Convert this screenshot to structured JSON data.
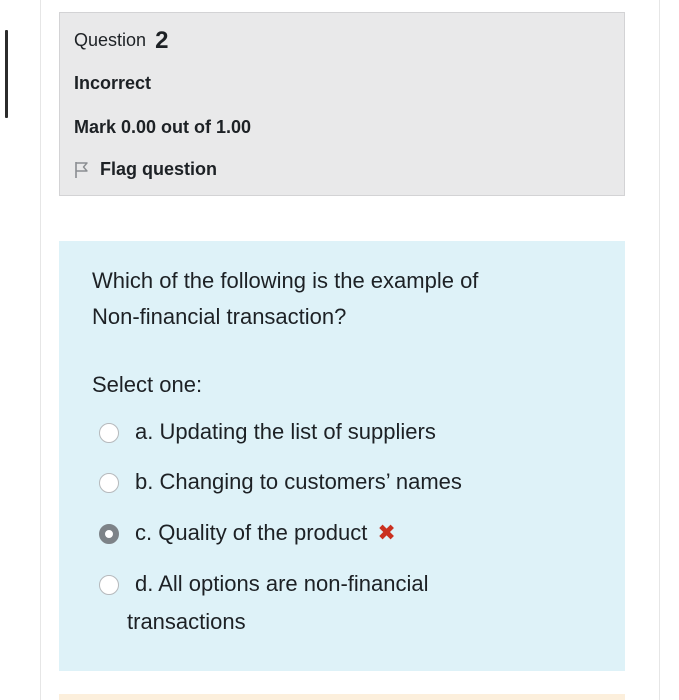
{
  "question_info": {
    "label": "Question",
    "number": "2",
    "state": "Incorrect",
    "grade": "Mark 0.00 out of 1.00",
    "flag_label": "Flag question"
  },
  "question": {
    "text_line1": "Which of the following is the example of",
    "text_line2": "Non-financial transaction?",
    "prompt": "Select one:",
    "answers": [
      {
        "label": "a. Updating the list of suppliers",
        "selected": false
      },
      {
        "label": "b. Changing to customers’ names",
        "selected": false
      },
      {
        "label": "c. Quality of the product",
        "selected": true,
        "result": "incorrect"
      },
      {
        "label_line1": "d. All options are non-financial",
        "label_line2": "transactions",
        "selected": false
      }
    ]
  },
  "colors": {
    "info_bg": "#e9e9ea",
    "question_bg": "#def2f8",
    "incorrect": "#ca3120"
  },
  "icons": {
    "flag": "flag-icon",
    "incorrect": "cross-icon"
  }
}
